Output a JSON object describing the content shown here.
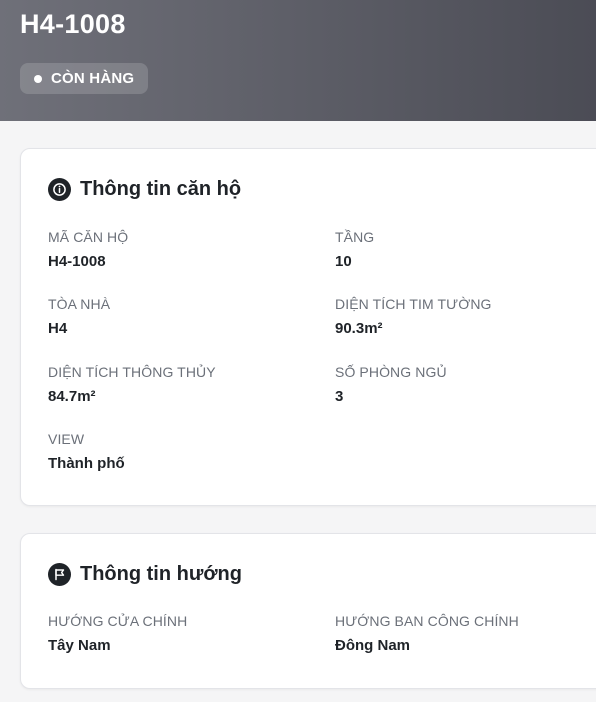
{
  "header": {
    "code": "H4-1008",
    "status": "CÒN HÀNG"
  },
  "apartment_info": {
    "title": "Thông tin căn hộ",
    "icon": "info-icon",
    "fields": [
      {
        "label": "MÃ CĂN HỘ",
        "value": "H4-1008"
      },
      {
        "label": "TẦNG",
        "value": "10"
      },
      {
        "label": "TÒA NHÀ",
        "value": "H4"
      },
      {
        "label": "DIỆN TÍCH TIM TƯỜNG",
        "value": "90.3m²"
      },
      {
        "label": "DIỆN TÍCH THÔNG THỦY",
        "value": "84.7m²"
      },
      {
        "label": "SỐ PHÒNG NGỦ",
        "value": "3"
      },
      {
        "label": "VIEW",
        "value": "Thành phố"
      }
    ]
  },
  "direction_info": {
    "title": "Thông tin hướng",
    "icon": "flag-icon",
    "fields": [
      {
        "label": "HƯỚNG CỬA CHÍNH",
        "value": "Tây Nam"
      },
      {
        "label": "HƯỚNG BAN CÔNG CHÍNH",
        "value": "Đông Nam"
      }
    ]
  },
  "colors": {
    "header_gradient_start": "#6f7079",
    "header_gradient_end": "#4b4c55",
    "text_dark": "#1f2328",
    "label_gray": "#6b7079",
    "page_bg": "#f5f5f6"
  }
}
